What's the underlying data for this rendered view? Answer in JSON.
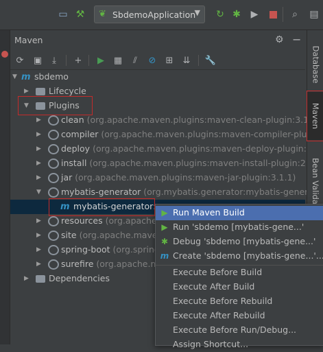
{
  "toolbar": {
    "run_config": "SbdemoApplication"
  },
  "maven": {
    "title": "Maven"
  },
  "tree": {
    "root": "sbdemo",
    "lifecycle": "Lifecycle",
    "plugins": "Plugins",
    "dependencies": "Dependencies",
    "plugin_items": [
      {
        "name": "clean",
        "coord": "(org.apache.maven.plugins:maven-clean-plugin:3.1.0)"
      },
      {
        "name": "compiler",
        "coord": "(org.apache.maven.plugins:maven-compiler-plugin:3"
      },
      {
        "name": "deploy",
        "coord": "(org.apache.maven.plugins:maven-deploy-plugin:2.8.2)"
      },
      {
        "name": "install",
        "coord": "(org.apache.maven.plugins:maven-install-plugin:2.5.2)"
      },
      {
        "name": "jar",
        "coord": "(org.apache.maven.plugins:maven-jar-plugin:3.1.1)"
      },
      {
        "name": "mybatis-generator",
        "coord": "(org.mybatis.generator:mybatis-generator-"
      },
      {
        "name": "resources",
        "coord": "(org.apache.m"
      },
      {
        "name": "site",
        "coord": "(org.apache.maven."
      },
      {
        "name": "spring-boot",
        "coord": "(org.spring"
      },
      {
        "name": "surefire",
        "coord": "(org.apache.ma"
      }
    ],
    "goal": "mybatis-generator:g"
  },
  "context_menu": {
    "items": [
      {
        "label": "Run Maven Build",
        "icon": "run-icon"
      },
      {
        "label": "Run 'sbdemo [mybatis-gene...'",
        "icon": "run-icon"
      },
      {
        "label": "Debug 'sbdemo [mybatis-gene...'",
        "icon": "debug-icon"
      },
      {
        "label": "Create 'sbdemo [mybatis-gene...'...",
        "icon": "maven-icon"
      },
      {
        "label": "Execute Before Build"
      },
      {
        "label": "Execute After Build"
      },
      {
        "label": "Execute Before Rebuild"
      },
      {
        "label": "Execute After Rebuild"
      },
      {
        "label": "Execute Before Run/Debug..."
      },
      {
        "label": "Assign Shortcut..."
      }
    ]
  },
  "right_tabs": {
    "database": "Database",
    "maven": "Maven",
    "bean_validation": "Bean Valida"
  },
  "colors": {
    "background": "#3c3f41",
    "selection": "#4b6eaf",
    "highlight_box": "#c42b2b",
    "run_green": "#499c54",
    "maven_blue": "#3592c4"
  }
}
